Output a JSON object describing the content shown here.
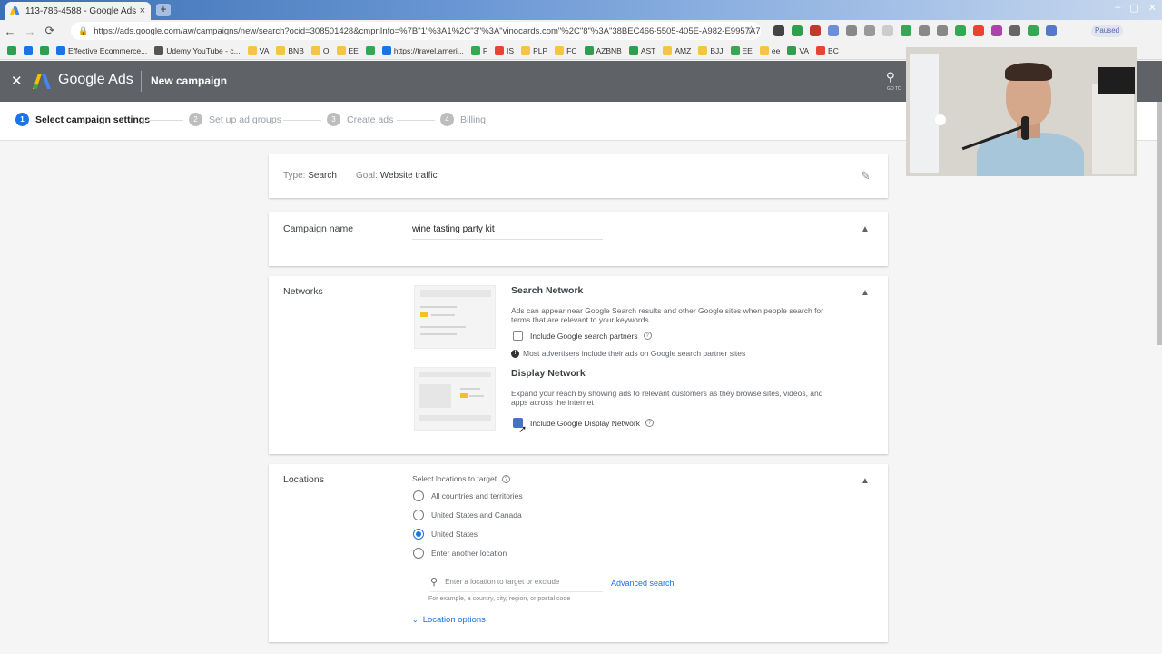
{
  "browser": {
    "tab_title": "113-786-4588 - Google Ads",
    "tab_close": "×",
    "new_tab": "+",
    "window_controls": [
      "–",
      "▢",
      "✕"
    ],
    "url": "https://ads.google.com/aw/campaigns/new/search?ocid=308501428&cmpnInfo=%7B\"1\"%3A1%2C\"3\"%3A\"vinocards.com\"%2C\"8\"%3A\"38BEC466-5505-405E-A982-E9957A7...",
    "paused_label": "Paused",
    "bookmarks": [
      {
        "label": "",
        "color": "#2e9e4f"
      },
      {
        "label": "",
        "color": "#1a73e8"
      },
      {
        "label": "",
        "color": "#2e9e4f"
      },
      {
        "label": "Effective Ecommerce...",
        "color": "#1a73e8"
      },
      {
        "label": "Udemy YouTube - c...",
        "color": "#555555"
      },
      {
        "label": "VA",
        "color": "#f4c542"
      },
      {
        "label": "BNB",
        "color": "#f4c542"
      },
      {
        "label": "O",
        "color": "#f4c542"
      },
      {
        "label": "EE",
        "color": "#f4c542"
      },
      {
        "label": "",
        "color": "#34a853"
      },
      {
        "label": "https://travel.ameri...",
        "color": "#1a73e8"
      },
      {
        "label": "F",
        "color": "#34a853"
      },
      {
        "label": "IS",
        "color": "#ea4335"
      },
      {
        "label": "PLP",
        "color": "#f4c542"
      },
      {
        "label": "FC",
        "color": "#f4c542"
      },
      {
        "label": "AZBNB",
        "color": "#2e9e4f"
      },
      {
        "label": "AST",
        "color": "#2e9e4f"
      },
      {
        "label": "AMZ",
        "color": "#f4c542"
      },
      {
        "label": "BJJ",
        "color": "#f4c542"
      },
      {
        "label": "EE",
        "color": "#34a853"
      },
      {
        "label": "ee",
        "color": "#f4c542"
      },
      {
        "label": "VA",
        "color": "#2e9e4f"
      },
      {
        "label": "BC",
        "color": "#ea4335"
      }
    ],
    "extension_colors": [
      "#444444",
      "#2e9e4f",
      "#c0392b",
      "#6a8fd8",
      "#888888",
      "#999999",
      "#cccccc",
      "#34a853",
      "#888888",
      "#888888",
      "#34a853",
      "#ea4335",
      "#aa44aa",
      "#666666",
      "#34a853",
      "#5577cc"
    ]
  },
  "header": {
    "close": "✕",
    "brand": "Google Ads",
    "page_title": "New campaign",
    "search": "🔍",
    "goto": "GO TO"
  },
  "stepper": {
    "steps": [
      {
        "num": "1",
        "label": "Select campaign settings"
      },
      {
        "num": "2",
        "label": "Set up ad groups"
      },
      {
        "num": "3",
        "label": "Create ads"
      },
      {
        "num": "4",
        "label": "Billing"
      }
    ]
  },
  "summary": {
    "type_key": "Type:",
    "type_value": "Search",
    "goal_key": "Goal:",
    "goal_value": "Website traffic",
    "edit": "✎"
  },
  "campaign_name": {
    "label": "Campaign name",
    "value": "wine tasting party kit",
    "chevron": "▲"
  },
  "networks": {
    "label": "Networks",
    "chevron": "▲",
    "search_title": "Search Network",
    "search_desc": "Ads can appear near Google Search results and other Google sites when people search for terms that are relevant to your keywords",
    "search_partners": "Include Google search partners",
    "search_partners_checked": false,
    "info_text": "Most advertisers include their ads on Google search partner sites",
    "display_title": "Display Network",
    "display_desc": "Expand your reach by showing ads to relevant customers as they browse sites, videos, and apps across the internet",
    "display_include": "Include Google Display Network",
    "display_checked": true,
    "help": "?",
    "info": "!"
  },
  "locations": {
    "label": "Locations",
    "chevron": "▲",
    "subtitle": "Select locations to target",
    "options": [
      {
        "label": "All countries and territories",
        "selected": false
      },
      {
        "label": "United States and Canada",
        "selected": false
      },
      {
        "label": "United States",
        "selected": true
      },
      {
        "label": "Enter another location",
        "selected": false
      }
    ],
    "search_placeholder": "Enter a location to target or exclude",
    "advanced": "Advanced search",
    "hint": "For example, a country, city, region, or postal code",
    "location_options": "Location options",
    "expand": "⌄"
  },
  "colors": {
    "accent": "#1a73e8",
    "header_bg": "#5f6368"
  }
}
